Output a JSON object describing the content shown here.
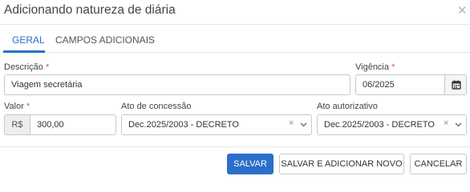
{
  "dialog": {
    "title": "Adicionando natureza de diária",
    "close_icon": "close-icon",
    "close_glyph": "✕"
  },
  "tabs": [
    {
      "label": "GERAL",
      "active": true
    },
    {
      "label": "CAMPOS ADICIONAIS",
      "active": false
    }
  ],
  "form": {
    "descricao": {
      "label": "Descrição",
      "required_mark": "*",
      "value": "Viagem secretária"
    },
    "vigencia": {
      "label": "Vigência",
      "required_mark": "*",
      "value": "06/2025",
      "icon": "calendar-icon"
    },
    "valor": {
      "label": "Valor",
      "required_mark": "*",
      "prefix": "R$",
      "value": "300,00"
    },
    "ato_concessao": {
      "label": "Ato de concessão",
      "value": "Dec.2025/2003 - DECRETO",
      "clear_glyph": "×",
      "caret_icon": "chevron-down-icon"
    },
    "ato_autorizativo": {
      "label": "Ato autorizativo",
      "value": "Dec.2025/2003 - DECRETO",
      "clear_glyph": "×",
      "caret_icon": "chevron-down-icon"
    }
  },
  "buttons": {
    "save": "SALVAR",
    "save_and_new": "SALVAR E ADICIONAR NOVO",
    "cancel": "CANCELAR"
  },
  "colors": {
    "primary": "#2a6fc9",
    "required": "#d9534f",
    "border": "#c8c8c8"
  }
}
